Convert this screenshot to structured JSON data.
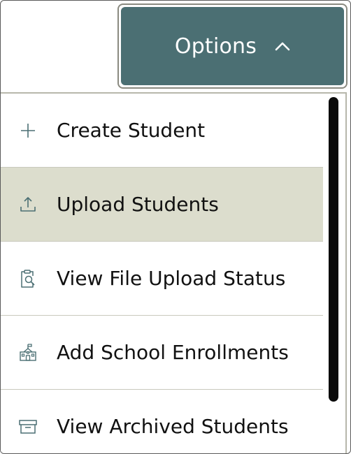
{
  "options_button": {
    "label": "Options",
    "icon": "chevron-up-icon"
  },
  "menu": {
    "items": [
      {
        "label": "Create Student",
        "icon": "plus-icon"
      },
      {
        "label": "Upload Students",
        "icon": "upload-icon",
        "highlighted": true
      },
      {
        "label": "View File Upload Status",
        "icon": "clipboard-search-icon"
      },
      {
        "label": "Add School Enrollments",
        "icon": "school-icon"
      },
      {
        "label": "View Archived Students",
        "icon": "archive-box-icon"
      }
    ]
  },
  "colors": {
    "button_bg": "#4b6f73",
    "highlight_bg": "#dcddcd",
    "icon": "#4b6f73",
    "text": "#111111"
  }
}
